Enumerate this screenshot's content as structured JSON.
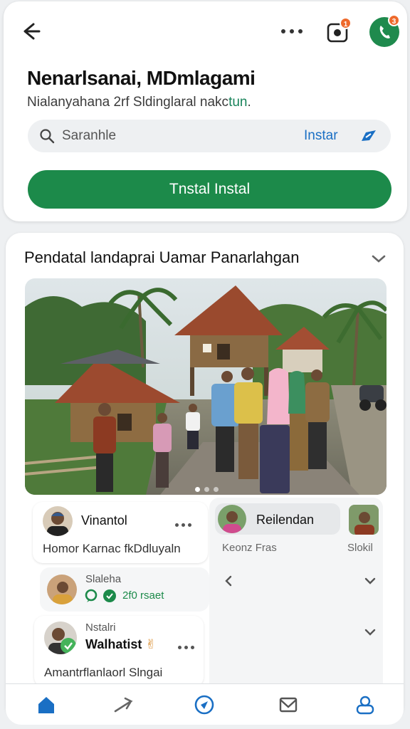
{
  "header": {
    "title": "Nenarlsanai, MDmlagami",
    "subtitle_main": "Nialanyahana 2rf Sldinglaral nakc",
    "subtitle_accent": "tun",
    "subtitle_end": ".",
    "icons": {
      "back": "arrow-left-icon",
      "more": "more-dots-icon",
      "camera": "camera-icon",
      "call": "phone-icon"
    },
    "camera_badge": "1",
    "call_badge": "3"
  },
  "search": {
    "placeholder": "Saranhle",
    "action_label": "Instar"
  },
  "install_button": {
    "label": "Tnstal Instal"
  },
  "section": {
    "title": "Pendatal landaprai Uamar Panarlahgan"
  },
  "feed": {
    "post1": {
      "name": "Vinantol",
      "text": "Homor Karnac fkDdluyaln"
    },
    "comment": {
      "name": "Slaleha",
      "time": "2f0 rsaet"
    },
    "post2": {
      "meta": "Nstalri",
      "name": "Walhatist",
      "emoji": "✌",
      "text": "Amantrflanlaorl Slngai"
    },
    "right": {
      "chip_name": "Reilendan",
      "caption_left": "Keonz Fras",
      "caption_right": "Slokil"
    }
  },
  "bottom_nav": {
    "items": [
      "home-icon",
      "send-icon",
      "explore-icon",
      "mail-icon",
      "profile-icon"
    ]
  },
  "colors": {
    "accent_green": "#1c8a4a",
    "link_blue": "#1a6fc4",
    "badge_orange": "#ee6a2c"
  }
}
